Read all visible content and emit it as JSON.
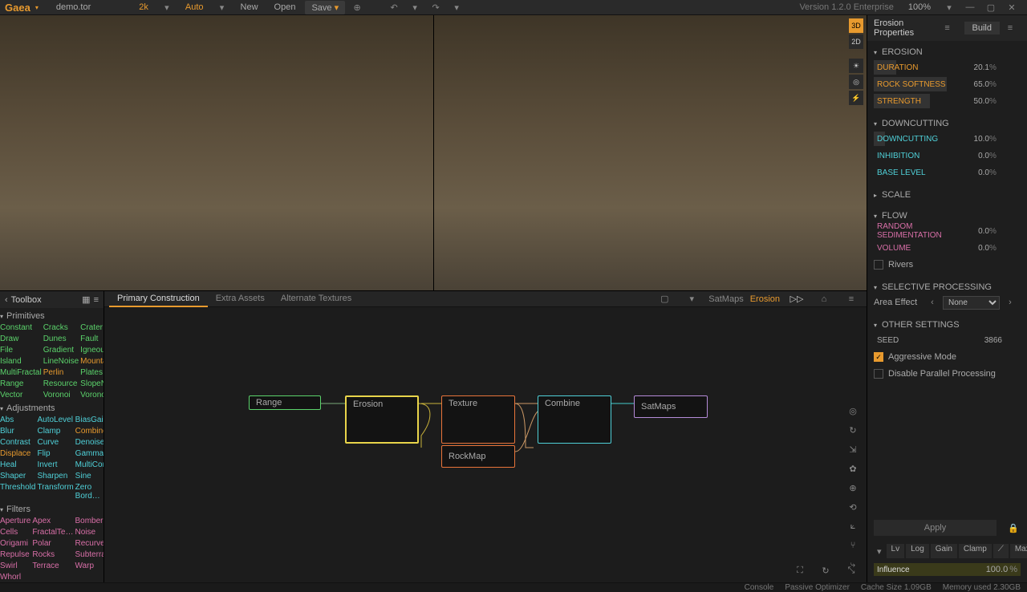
{
  "app": {
    "name": "Gaea",
    "file": "demo.tor",
    "version": "Version 1.2.0 Enterprise",
    "zoom": "100%"
  },
  "topbar": {
    "res": "2k",
    "auto": "Auto",
    "new": "New",
    "open": "Open",
    "save": "Save"
  },
  "viewTools": {
    "d3": "3D",
    "d2": "2D"
  },
  "toolbox": {
    "title": "Toolbox",
    "cats": [
      {
        "name": "Primitives",
        "items": [
          {
            "t": "Constant",
            "c": "c-green"
          },
          {
            "t": "Cracks",
            "c": "c-green"
          },
          {
            "t": "Crater",
            "c": "c-green"
          },
          {
            "t": "Draw",
            "c": "c-green"
          },
          {
            "t": "Dunes",
            "c": "c-green"
          },
          {
            "t": "Fault",
            "c": "c-green"
          },
          {
            "t": "File",
            "c": "c-green"
          },
          {
            "t": "Gradient",
            "c": "c-green"
          },
          {
            "t": "Igneous",
            "c": "c-green"
          },
          {
            "t": "Island",
            "c": "c-green"
          },
          {
            "t": "LineNoise",
            "c": "c-green"
          },
          {
            "t": "Mountain",
            "c": "c-orange"
          },
          {
            "t": "MultiFractal",
            "c": "c-green"
          },
          {
            "t": "Perlin",
            "c": "c-orange"
          },
          {
            "t": "Plates",
            "c": "c-green"
          },
          {
            "t": "Range",
            "c": "c-green"
          },
          {
            "t": "Resource",
            "c": "c-green"
          },
          {
            "t": "SlopeNoise",
            "c": "c-green"
          },
          {
            "t": "Vector",
            "c": "c-green"
          },
          {
            "t": "Voronoi",
            "c": "c-green"
          },
          {
            "t": "Voronoi+",
            "c": "c-green"
          }
        ]
      },
      {
        "name": "Adjustments",
        "items": [
          {
            "t": "Abs",
            "c": "c-cyan"
          },
          {
            "t": "AutoLevel",
            "c": "c-cyan"
          },
          {
            "t": "BiasGain",
            "c": "c-cyan"
          },
          {
            "t": "Blur",
            "c": "c-cyan"
          },
          {
            "t": "Clamp",
            "c": "c-cyan"
          },
          {
            "t": "Combine",
            "c": "c-orange"
          },
          {
            "t": "Contrast",
            "c": "c-cyan"
          },
          {
            "t": "Curve",
            "c": "c-cyan"
          },
          {
            "t": "Denoise",
            "c": "c-cyan"
          },
          {
            "t": "Displace",
            "c": "c-orange"
          },
          {
            "t": "Flip",
            "c": "c-cyan"
          },
          {
            "t": "Gamma",
            "c": "c-cyan"
          },
          {
            "t": "Heal",
            "c": "c-cyan"
          },
          {
            "t": "Invert",
            "c": "c-cyan"
          },
          {
            "t": "MultiCom…",
            "c": "c-cyan"
          },
          {
            "t": "Shaper",
            "c": "c-cyan"
          },
          {
            "t": "Sharpen",
            "c": "c-cyan"
          },
          {
            "t": "Sine",
            "c": "c-cyan"
          },
          {
            "t": "Threshold",
            "c": "c-cyan"
          },
          {
            "t": "Transform",
            "c": "c-cyan"
          },
          {
            "t": "Zero Bord…",
            "c": "c-cyan"
          }
        ]
      },
      {
        "name": "Filters",
        "items": [
          {
            "t": "Aperture",
            "c": "c-pink"
          },
          {
            "t": "Apex",
            "c": "c-pink"
          },
          {
            "t": "Bomber",
            "c": "c-pink"
          },
          {
            "t": "Cells",
            "c": "c-pink"
          },
          {
            "t": "FractalTe…",
            "c": "c-pink"
          },
          {
            "t": "Noise",
            "c": "c-pink"
          },
          {
            "t": "Origami",
            "c": "c-pink"
          },
          {
            "t": "Polar",
            "c": "c-pink"
          },
          {
            "t": "Recurve",
            "c": "c-pink"
          },
          {
            "t": "Repulse",
            "c": "c-pink"
          },
          {
            "t": "Rocks",
            "c": "c-pink"
          },
          {
            "t": "Subterrace",
            "c": "c-pink"
          },
          {
            "t": "Swirl",
            "c": "c-pink"
          },
          {
            "t": "Terrace",
            "c": "c-pink"
          },
          {
            "t": "Warp",
            "c": "c-pink"
          },
          {
            "t": "Whorl",
            "c": "c-pink"
          }
        ]
      }
    ]
  },
  "graph": {
    "tabs": [
      "Primary Construction",
      "Extra Assets",
      "Alternate Textures"
    ],
    "active": 0,
    "pins": [
      "SatMaps",
      "Erosion"
    ],
    "nodes": {
      "range": "Range",
      "erosion": "Erosion",
      "texture": "Texture",
      "combine": "Combine",
      "satmaps": "SatMaps",
      "rockmap": "RockMap"
    }
  },
  "props": {
    "title": "Erosion Properties",
    "build": "Build",
    "sections": {
      "erosion": {
        "title": "EROSION",
        "rows": [
          {
            "k": "duration",
            "label": "DURATION",
            "val": "20.1",
            "unit": "%",
            "pct": 20,
            "c": "lbl-orange"
          },
          {
            "k": "rock",
            "label": "ROCK SOFTNESS",
            "val": "65.0",
            "unit": "%",
            "pct": 65,
            "c": "lbl-orange"
          },
          {
            "k": "strength",
            "label": "STRENGTH",
            "val": "50.0",
            "unit": "%",
            "pct": 50,
            "c": "lbl-orange"
          }
        ]
      },
      "down": {
        "title": "DOWNCUTTING",
        "rows": [
          {
            "k": "dc",
            "label": "DOWNCUTTING",
            "val": "10.0",
            "unit": "%",
            "pct": 10,
            "c": "lbl-cyan"
          },
          {
            "k": "inh",
            "label": "INHIBITION",
            "val": "0.0",
            "unit": "%",
            "pct": 0,
            "c": "lbl-cyan"
          },
          {
            "k": "base",
            "label": "BASE LEVEL",
            "val": "0.0",
            "unit": "%",
            "pct": 0,
            "c": "lbl-cyan"
          }
        ]
      },
      "scale": {
        "title": "SCALE"
      },
      "flow": {
        "title": "FLOW",
        "rows": [
          {
            "k": "rand",
            "label": "RANDOM SEDIMENTATION",
            "val": "0.0",
            "unit": "%",
            "pct": 0,
            "c": "lbl-pink"
          },
          {
            "k": "vol",
            "label": "VOLUME",
            "val": "0.0",
            "unit": "%",
            "pct": 0,
            "c": "lbl-pink"
          }
        ],
        "rivers": "Rivers"
      },
      "sel": {
        "title": "SELECTIVE PROCESSING",
        "area": "Area Effect",
        "none": "None"
      },
      "other": {
        "title": "OTHER SETTINGS",
        "seed_l": "SEED",
        "seed_v": "3866",
        "agg": "Aggressive Mode",
        "par": "Disable Parallel Processing"
      }
    },
    "apply": "Apply",
    "curves": [
      "Lv",
      "Log",
      "Gain",
      "Clamp",
      "⟋",
      "Max",
      "···"
    ],
    "influence_l": "Influence",
    "influence_v": "100.0",
    "influence_u": "%"
  },
  "status": {
    "console": "Console",
    "opt": "Passive Optimizer",
    "cache": "Cache Size 1.09GB",
    "mem": "Memory used 2.30GB"
  }
}
